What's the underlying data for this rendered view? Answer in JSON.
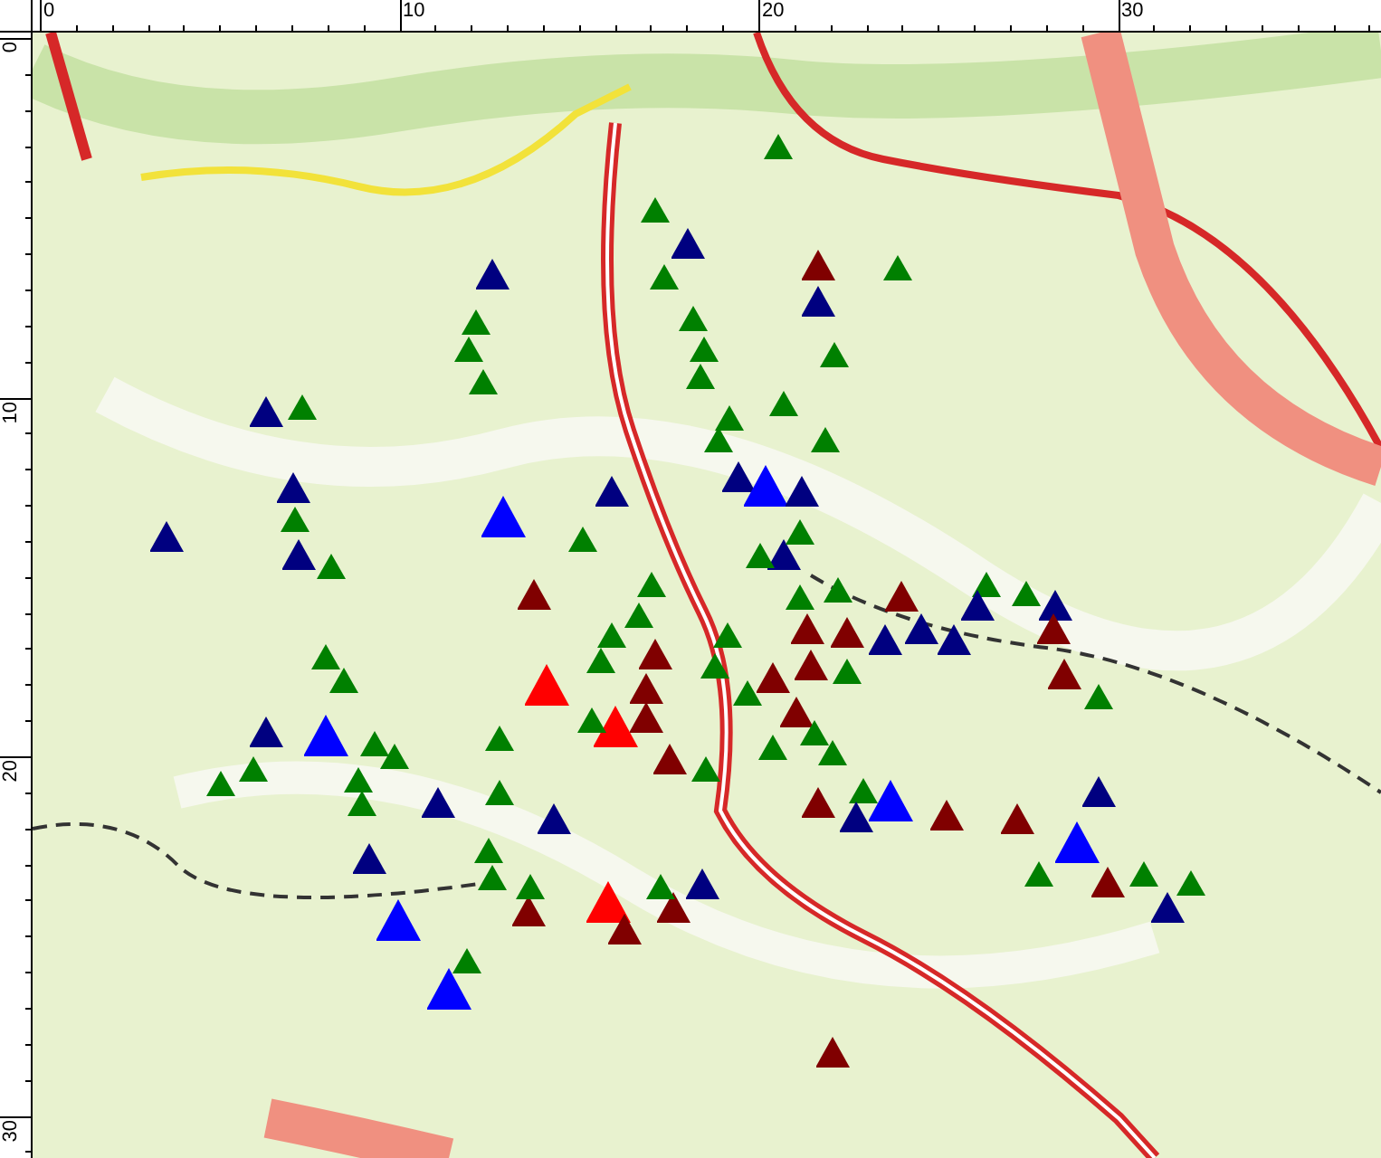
{
  "ruler_top": {
    "labels": [
      "0",
      "10",
      "20",
      "30"
    ]
  },
  "ruler_left": {
    "labels": [
      "0",
      "10",
      "20",
      "30"
    ]
  },
  "markers": [
    {
      "color": "#008000",
      "kind": "small"
    },
    {
      "color": "#008000",
      "kind": "small"
    },
    {
      "color": "#000080",
      "kind": "medium"
    },
    {
      "color": "#008000",
      "kind": "small"
    },
    {
      "color": "#000080",
      "kind": "medium"
    },
    {
      "color": "#800000",
      "kind": "medium"
    },
    {
      "color": "#000080",
      "kind": "medium"
    },
    {
      "color": "#008000",
      "kind": "small"
    },
    {
      "color": "#008000",
      "kind": "small"
    },
    {
      "color": "#008000",
      "kind": "small"
    },
    {
      "color": "#008000",
      "kind": "small"
    },
    {
      "color": "#008000",
      "kind": "small"
    },
    {
      "color": "#008000",
      "kind": "small"
    },
    {
      "color": "#008000",
      "kind": "small"
    },
    {
      "color": "#008000",
      "kind": "small"
    },
    {
      "color": "#008000",
      "kind": "small"
    },
    {
      "color": "#008000",
      "kind": "small"
    },
    {
      "color": "#008000",
      "kind": "small"
    },
    {
      "color": "#008000",
      "kind": "small"
    },
    {
      "color": "#000080",
      "kind": "medium"
    },
    {
      "color": "#008000",
      "kind": "small"
    },
    {
      "color": "#000080",
      "kind": "medium"
    },
    {
      "color": "#008000",
      "kind": "small"
    },
    {
      "color": "#000080",
      "kind": "medium"
    },
    {
      "color": "#008000",
      "kind": "small"
    },
    {
      "color": "#000080",
      "kind": "medium"
    },
    {
      "color": "#0000ff",
      "kind": "large"
    },
    {
      "color": "#008000",
      "kind": "small"
    },
    {
      "color": "#000080",
      "kind": "medium"
    },
    {
      "color": "#000080",
      "kind": "medium"
    },
    {
      "color": "#0000ff",
      "kind": "large"
    },
    {
      "color": "#000080",
      "kind": "medium"
    },
    {
      "color": "#000080",
      "kind": "medium"
    },
    {
      "color": "#008000",
      "kind": "small"
    },
    {
      "color": "#008000",
      "kind": "small"
    },
    {
      "color": "#800000",
      "kind": "medium"
    },
    {
      "color": "#008000",
      "kind": "small"
    },
    {
      "color": "#008000",
      "kind": "small"
    },
    {
      "color": "#008000",
      "kind": "small"
    },
    {
      "color": "#008000",
      "kind": "small"
    },
    {
      "color": "#800000",
      "kind": "medium"
    },
    {
      "color": "#800000",
      "kind": "medium"
    },
    {
      "color": "#800000",
      "kind": "medium"
    },
    {
      "color": "#ff0000",
      "kind": "large"
    },
    {
      "color": "#ff0000",
      "kind": "large"
    },
    {
      "color": "#008000",
      "kind": "small"
    },
    {
      "color": "#800000",
      "kind": "medium"
    },
    {
      "color": "#008000",
      "kind": "small"
    },
    {
      "color": "#008000",
      "kind": "small"
    },
    {
      "color": "#008000",
      "kind": "small"
    },
    {
      "color": "#008000",
      "kind": "small"
    },
    {
      "color": "#800000",
      "kind": "medium"
    },
    {
      "color": "#800000",
      "kind": "medium"
    },
    {
      "color": "#008000",
      "kind": "small"
    },
    {
      "color": "#008000",
      "kind": "small"
    },
    {
      "color": "#008000",
      "kind": "small"
    },
    {
      "color": "#008000",
      "kind": "small"
    },
    {
      "color": "#008000",
      "kind": "small"
    },
    {
      "color": "#800000",
      "kind": "medium"
    },
    {
      "color": "#800000",
      "kind": "medium"
    },
    {
      "color": "#000080",
      "kind": "medium"
    },
    {
      "color": "#800000",
      "kind": "medium"
    },
    {
      "color": "#008000",
      "kind": "small"
    },
    {
      "color": "#800000",
      "kind": "medium"
    },
    {
      "color": "#000080",
      "kind": "medium"
    },
    {
      "color": "#000080",
      "kind": "medium"
    },
    {
      "color": "#008000",
      "kind": "small"
    },
    {
      "color": "#000080",
      "kind": "medium"
    },
    {
      "color": "#008000",
      "kind": "small"
    },
    {
      "color": "#000080",
      "kind": "medium"
    },
    {
      "color": "#800000",
      "kind": "medium"
    },
    {
      "color": "#800000",
      "kind": "medium"
    },
    {
      "color": "#008000",
      "kind": "small"
    },
    {
      "color": "#800000",
      "kind": "medium"
    },
    {
      "color": "#008000",
      "kind": "small"
    },
    {
      "color": "#000080",
      "kind": "medium"
    },
    {
      "color": "#0000ff",
      "kind": "large"
    },
    {
      "color": "#800000",
      "kind": "medium"
    },
    {
      "color": "#800000",
      "kind": "medium"
    },
    {
      "color": "#000080",
      "kind": "medium"
    },
    {
      "color": "#0000ff",
      "kind": "large"
    },
    {
      "color": "#008000",
      "kind": "small"
    },
    {
      "color": "#800000",
      "kind": "medium"
    },
    {
      "color": "#008000",
      "kind": "small"
    },
    {
      "color": "#008000",
      "kind": "small"
    },
    {
      "color": "#000080",
      "kind": "medium"
    },
    {
      "color": "#000080",
      "kind": "medium"
    },
    {
      "color": "#008000",
      "kind": "small"
    },
    {
      "color": "#008000",
      "kind": "small"
    },
    {
      "color": "#000080",
      "kind": "medium"
    },
    {
      "color": "#0000ff",
      "kind": "large"
    },
    {
      "color": "#008000",
      "kind": "small"
    },
    {
      "color": "#008000",
      "kind": "small"
    },
    {
      "color": "#008000",
      "kind": "small"
    },
    {
      "color": "#008000",
      "kind": "small"
    },
    {
      "color": "#008000",
      "kind": "small"
    },
    {
      "color": "#008000",
      "kind": "small"
    },
    {
      "color": "#000080",
      "kind": "medium"
    },
    {
      "color": "#000080",
      "kind": "medium"
    },
    {
      "color": "#0000ff",
      "kind": "large"
    },
    {
      "color": "#008000",
      "kind": "small"
    },
    {
      "color": "#008000",
      "kind": "small"
    },
    {
      "color": "#008000",
      "kind": "small"
    },
    {
      "color": "#008000",
      "kind": "small"
    },
    {
      "color": "#000080",
      "kind": "medium"
    },
    {
      "color": "#ff0000",
      "kind": "large"
    },
    {
      "color": "#800000",
      "kind": "medium"
    },
    {
      "color": "#800000",
      "kind": "medium"
    },
    {
      "color": "#008000",
      "kind": "small"
    },
    {
      "color": "#800000",
      "kind": "medium"
    },
    {
      "color": "#008000",
      "kind": "small"
    },
    {
      "color": "#008000",
      "kind": "small"
    },
    {
      "color": "#0000ff",
      "kind": "large"
    },
    {
      "color": "#800000",
      "kind": "medium"
    }
  ]
}
